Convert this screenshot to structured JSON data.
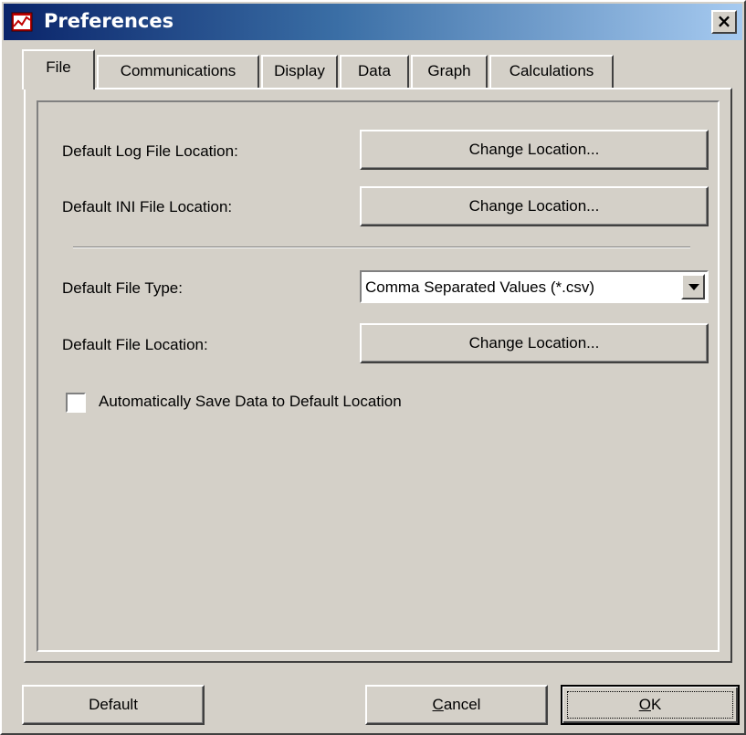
{
  "window": {
    "title": "Preferences",
    "close_label": "×"
  },
  "tabs": [
    {
      "label": "File",
      "active": true
    },
    {
      "label": "Communications",
      "active": false
    },
    {
      "label": "Display",
      "active": false
    },
    {
      "label": "Data",
      "active": false
    },
    {
      "label": "Graph",
      "active": false
    },
    {
      "label": "Calculations",
      "active": false
    }
  ],
  "file_tab": {
    "log_location_label": "Default Log File Location:",
    "log_location_button": "Change Location...",
    "ini_location_label": "Default INI File Location:",
    "ini_location_button": "Change Location...",
    "file_type_label": "Default File Type:",
    "file_type_value": "Comma Separated Values (*.csv)",
    "file_location_label": "Default File Location:",
    "file_location_button": "Change Location...",
    "autosave_label": "Automatically Save Data to Default Location",
    "autosave_checked": false
  },
  "footer": {
    "default_label": "Default",
    "cancel_label": "Cancel",
    "cancel_mnemonic": "C",
    "cancel_rest": "ancel",
    "ok_label": "OK",
    "ok_mnemonic": "O",
    "ok_rest": "K"
  },
  "icons": {
    "app_icon": "chart-window-icon",
    "close": "close-icon",
    "dropdown": "chevron-down-icon"
  }
}
